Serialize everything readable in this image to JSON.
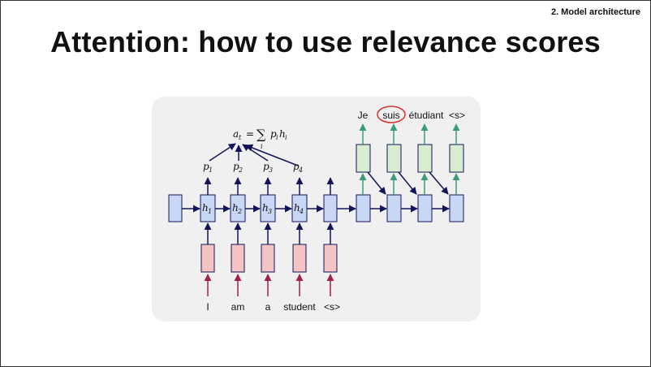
{
  "header": {
    "section": "2. Model architecture",
    "title": "Attention: how to use relevance scores"
  },
  "diagram": {
    "source_words": [
      "I",
      "am",
      "a",
      "student",
      "<s>"
    ],
    "target_words": [
      "Je",
      "suis",
      "étudiant",
      "<s>"
    ],
    "highlighted_target": "suis",
    "hidden_labels": [
      "h",
      "h",
      "h",
      "h"
    ],
    "hidden_subscripts": [
      "1",
      "2",
      "3",
      "4"
    ],
    "weight_labels": [
      "p",
      "p",
      "p",
      "p"
    ],
    "weight_subscripts": [
      "1",
      "2",
      "3",
      "4"
    ],
    "formula": {
      "lhs": "a",
      "lhs_sub": "t",
      "eq": "=",
      "sum": "∑",
      "sum_sub": "i",
      "p": "p",
      "p_sub": "i",
      "h": "h",
      "h_sub": "i"
    },
    "colors": {
      "encoder_cell": "#c8d8f4",
      "embedding_cell": "#f4c4c4",
      "output_cell": "#d8ecd0",
      "input_arrow": "#a0204a",
      "output_arrow": "#3a9a7a",
      "dark_arrow": "#14145a",
      "highlight": "#d83030"
    }
  }
}
